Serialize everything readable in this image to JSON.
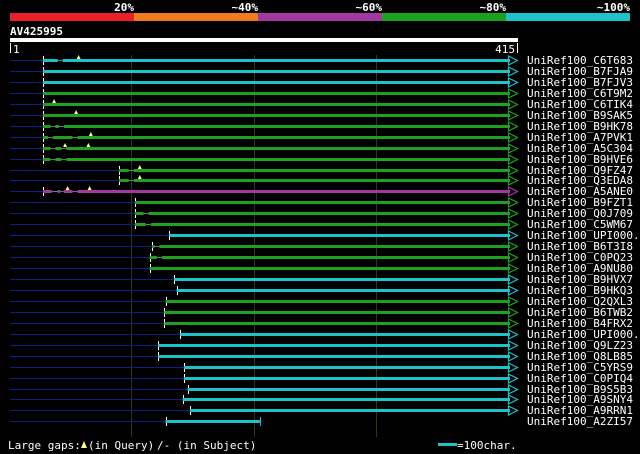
{
  "score_legend": [
    {
      "label": "20%",
      "color": "#e8202a"
    },
    {
      "label": "~40%",
      "color": "#ef7d1a"
    },
    {
      "label": "~60%",
      "color": "#a238a0"
    },
    {
      "label": "~80%",
      "color": "#1da21d"
    },
    {
      "label": "~100%",
      "color": "#1cc3c9"
    }
  ],
  "query": {
    "name": "AV425995",
    "start": "1",
    "end": "415",
    "length": 415
  },
  "hits": [
    {
      "name": "UniRef100_C6T683",
      "start": 28,
      "end": 415,
      "color": "#1cc3c9",
      "gaps": [
        [
          40,
          44
        ]
      ],
      "tri": [
        57
      ]
    },
    {
      "name": "UniRef100_B7FJA9",
      "start": 28,
      "end": 415,
      "color": "#1cc3c9",
      "gaps": [],
      "tri": []
    },
    {
      "name": "UniRef100_B7FJV3",
      "start": 28,
      "end": 415,
      "color": "#1cc3c9",
      "gaps": [],
      "tri": []
    },
    {
      "name": "UniRef100_C6T9M2",
      "start": 28,
      "end": 415,
      "color": "#1da21d",
      "gaps": [],
      "tri": []
    },
    {
      "name": "UniRef100_C6TIK4",
      "start": 28,
      "end": 415,
      "color": "#1da21d",
      "gaps": [],
      "tri": [
        37
      ]
    },
    {
      "name": "UniRef100_B9SAK5",
      "start": 28,
      "end": 415,
      "color": "#1da21d",
      "gaps": [],
      "tri": [
        55
      ]
    },
    {
      "name": "UniRef100_B9HK78",
      "start": 28,
      "end": 415,
      "color": "#1da21d",
      "gaps": [
        [
          34,
          38
        ],
        [
          41,
          45
        ]
      ],
      "tri": []
    },
    {
      "name": "UniRef100_A7PVK1",
      "start": 28,
      "end": 415,
      "color": "#1da21d",
      "gaps": [
        [
          32,
          36
        ],
        [
          52,
          56
        ]
      ],
      "tri": [
        67
      ]
    },
    {
      "name": "UniRef100_A5C304",
      "start": 28,
      "end": 415,
      "color": "#1da21d",
      "gaps": [
        [
          34,
          38
        ],
        [
          43,
          47
        ]
      ],
      "tri": [
        46,
        65
      ]
    },
    {
      "name": "UniRef100_B9HVE6",
      "start": 28,
      "end": 415,
      "color": "#1da21d",
      "gaps": [
        [
          34,
          38
        ],
        [
          43,
          47
        ]
      ],
      "tri": []
    },
    {
      "name": "UniRef100_Q9FZ47",
      "start": 90,
      "end": 415,
      "color": "#1da21d",
      "gaps": [
        [
          98,
          102
        ]
      ],
      "tri": [
        107
      ]
    },
    {
      "name": "UniRef100_Q3EDA8",
      "start": 90,
      "end": 415,
      "color": "#1da21d",
      "gaps": [
        [
          98,
          102
        ]
      ],
      "tri": [
        107
      ]
    },
    {
      "name": "UniRef100_A5ANE0",
      "start": 28,
      "end": 415,
      "color": "#a238a0",
      "gaps": [
        [
          35,
          40
        ],
        [
          42,
          45
        ],
        [
          52,
          56
        ]
      ],
      "tri": [
        48,
        66
      ]
    },
    {
      "name": "UniRef100_B9FZT1",
      "start": 103,
      "end": 415,
      "color": "#1da21d",
      "gaps": [],
      "tri": []
    },
    {
      "name": "UniRef100_Q0J709",
      "start": 103,
      "end": 415,
      "color": "#1da21d",
      "gaps": [
        [
          110,
          114
        ]
      ],
      "tri": []
    },
    {
      "name": "UniRef100_C5WM67",
      "start": 103,
      "end": 415,
      "color": "#1da21d",
      "gaps": [
        [
          112,
          116
        ]
      ],
      "tri": []
    },
    {
      "name": "UniRef100_UPI000..",
      "start": 131,
      "end": 415,
      "color": "#1cc3c9",
      "gaps": [],
      "tri": []
    },
    {
      "name": "UniRef100_B6T3I8",
      "start": 117,
      "end": 415,
      "color": "#1da21d",
      "gaps": [
        [
          119,
          123
        ]
      ],
      "tri": []
    },
    {
      "name": "UniRef100_C0PQ23",
      "start": 115,
      "end": 415,
      "color": "#1da21d",
      "gaps": [
        [
          121,
          125
        ]
      ],
      "tri": []
    },
    {
      "name": "UniRef100_A9NU80",
      "start": 115,
      "end": 415,
      "color": "#1da21d",
      "gaps": [],
      "tri": []
    },
    {
      "name": "UniRef100_B9HVX7",
      "start": 135,
      "end": 415,
      "color": "#1cc3c9",
      "gaps": [],
      "tri": []
    },
    {
      "name": "UniRef100_B9HKQ3",
      "start": 137,
      "end": 415,
      "color": "#1cc3c9",
      "gaps": [],
      "tri": []
    },
    {
      "name": "UniRef100_Q2QXL3",
      "start": 128,
      "end": 415,
      "color": "#1da21d",
      "gaps": [],
      "tri": []
    },
    {
      "name": "UniRef100_B6TWB2",
      "start": 127,
      "end": 415,
      "color": "#1da21d",
      "gaps": [],
      "tri": []
    },
    {
      "name": "UniRef100_B4FRX2",
      "start": 127,
      "end": 415,
      "color": "#1da21d",
      "gaps": [],
      "tri": []
    },
    {
      "name": "UniRef100_UPI000..",
      "start": 140,
      "end": 415,
      "color": "#1cc3c9",
      "gaps": [],
      "tri": []
    },
    {
      "name": "UniRef100_Q9LZ23",
      "start": 122,
      "end": 415,
      "color": "#1cc3c9",
      "gaps": [],
      "tri": []
    },
    {
      "name": "UniRef100_Q8LB85",
      "start": 122,
      "end": 415,
      "color": "#1cc3c9",
      "gaps": [],
      "tri": []
    },
    {
      "name": "UniRef100_C5YRS9",
      "start": 143,
      "end": 415,
      "color": "#1cc3c9",
      "gaps": [],
      "tri": []
    },
    {
      "name": "UniRef100_C0PIQ4",
      "start": 143,
      "end": 415,
      "color": "#1cc3c9",
      "gaps": [],
      "tri": []
    },
    {
      "name": "UniRef100_B9S5B3",
      "start": 146,
      "end": 415,
      "color": "#1cc3c9",
      "gaps": [],
      "tri": []
    },
    {
      "name": "UniRef100_A9SNY4",
      "start": 142,
      "end": 415,
      "color": "#1cc3c9",
      "gaps": [],
      "tri": []
    },
    {
      "name": "UniRef100_A9RRN1",
      "start": 148,
      "end": 415,
      "color": "#1cc3c9",
      "gaps": [],
      "tri": []
    },
    {
      "name": "UniRef100_A2ZI57",
      "start": 128,
      "end": 205,
      "color": "#1cc3c9",
      "gaps": [],
      "tri": []
    }
  ],
  "footer": {
    "large_gaps_label": "Large gaps:",
    "query_gap_label": "(in Query)",
    "subject_gap_label": "/- (in Subject)",
    "scale_label": "=100char."
  },
  "colors": {
    "background": "#000000",
    "query_bar": "#ffffff",
    "leading_line": "#0d1f86",
    "guide": "#2c3a1c",
    "gap_marker": "#ffff80"
  }
}
